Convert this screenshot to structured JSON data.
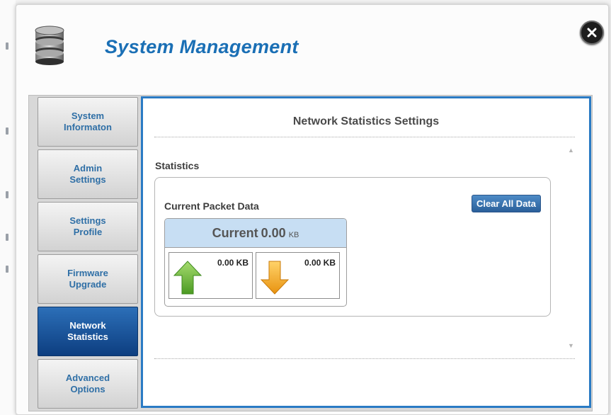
{
  "header": {
    "title": "System Management"
  },
  "sidebar": {
    "items": [
      {
        "label": "System\nInformaton"
      },
      {
        "label": "Admin\nSettings"
      },
      {
        "label": "Settings\nProfile"
      },
      {
        "label": "Firmware\nUpgrade"
      },
      {
        "label": "Network\nStatistics"
      },
      {
        "label": "Advanced\nOptions"
      }
    ],
    "active_index": 4
  },
  "content": {
    "title": "Network Statistics Settings",
    "section_label": "Statistics",
    "packet": {
      "label": "Current Packet Data",
      "clear_button": "Clear All Data",
      "current_label": "Current",
      "current_value": "0.00",
      "current_unit": "KB",
      "upload": "0.00 KB",
      "download": "0.00 KB"
    }
  },
  "icons": {
    "close": "close-icon",
    "database": "database-icon",
    "upload": "upload-arrow-icon",
    "download": "download-arrow-icon",
    "scroll_up": "scroll-up-icon",
    "scroll_down": "scroll-down-icon"
  },
  "colors": {
    "accent": "#1a6fb5",
    "active_nav": "#0d3e80",
    "content_border": "#2a7bc4",
    "packet_header": "#c7def3",
    "upload_arrow": "#6fb23a",
    "download_arrow": "#f0a41c"
  }
}
